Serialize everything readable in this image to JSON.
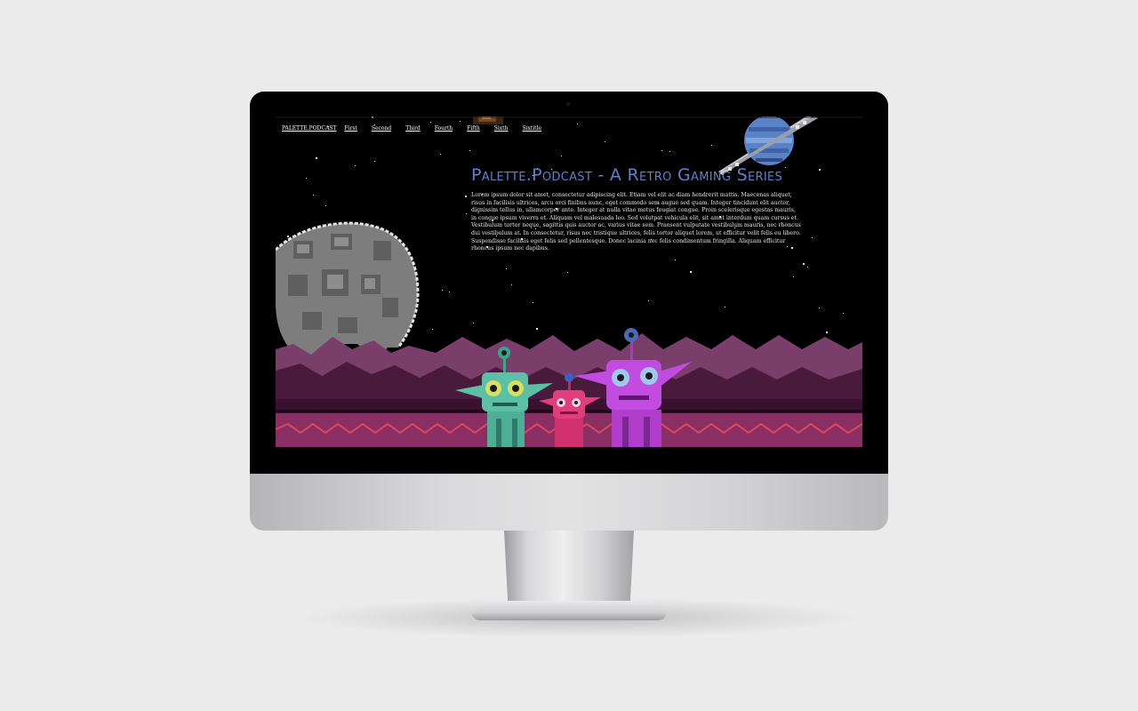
{
  "nav": {
    "brand": "PALETTE.PODCAST",
    "links": [
      "First",
      "Second",
      "Third",
      "Fourth",
      "Fifth",
      "Sixth",
      "Sixtitle"
    ]
  },
  "hero": {
    "title": "Palette.Podcast - A Retro Gaming Series",
    "body": "Lorem ipsum dolor sit amet, consectetur adipiscing elit. Etiam vel elit ac diam hendrerit mattis. Maecenas aliquet, risus in facilisis ultrices, arcu orci finibus nunc, eget commodo sem augue sed quam. Integer tincidunt elit auctor, dignissim tellus in, ullamcorper ante. Integer at nulla vitae metus feugiat congue. Proin scelerisque egestas mauris, in congue ipsum viverra et. Aliquam vel malesuada leo. Sed volutpat vehicula elit, sit amet interdum quam cursus et. Vestibulum tortor neque, sagittis quis auctor ac, varius vitae sem. Praesent vulputate vestibulum mauris, nec rhoncus dui vestibulum at. In consectetur, risus nec tristique ultrices, felis tortor aliquet lorem, ut efficitur velit felis eu libero. Suspendisse facilisis eget felis sed pellentesque. Donec lacinia nec felis condimentum fringilla. Aliquam efficitur rhoncus ipsum nec dapibus."
  },
  "icons": [
    "moon-icon",
    "planet-icon",
    "alien-teal-icon",
    "alien-pink-icon",
    "alien-purple-icon",
    "comet-icon"
  ],
  "colors": {
    "title": "#5c82c7",
    "screen_bg": "#000000",
    "mountain_far": "#7a3e6b",
    "mountain_near": "#4a1a3d",
    "ground": "#8a2f63"
  }
}
